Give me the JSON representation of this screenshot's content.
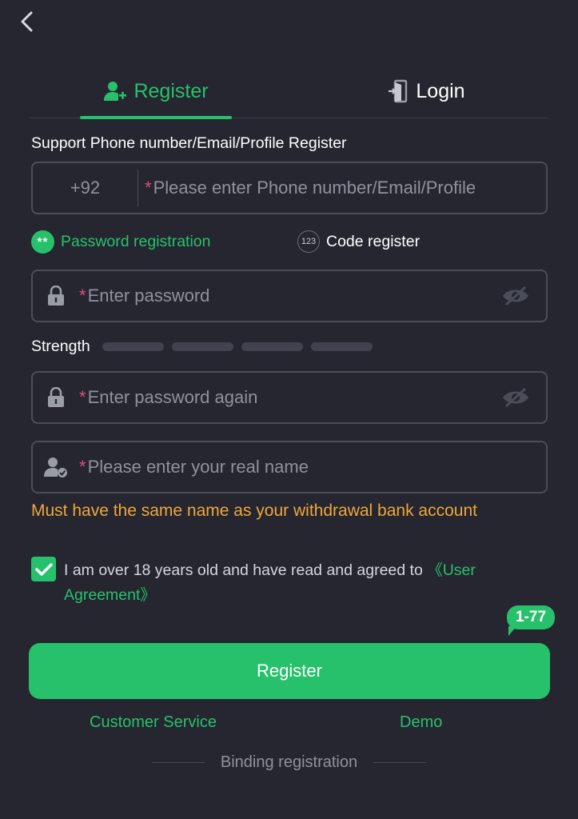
{
  "tabs": {
    "register": "Register",
    "login": "Login"
  },
  "form": {
    "support_label": "Support Phone number/Email/Profile Register",
    "country_code": "+92",
    "account_placeholder": "Please enter Phone number/Email/Profile",
    "required_mark": "*",
    "modes": {
      "password": "Password registration",
      "password_badge": "**",
      "code": "Code register",
      "code_badge": "123"
    },
    "password_placeholder": "Enter password",
    "strength_label": "Strength",
    "strength_level": 0,
    "password_again_placeholder": "Enter password again",
    "realname_placeholder": "Please enter your real name",
    "warning": "Must have the same name as your withdrawal bank account",
    "agreement_text": "I am over 18 years old and have read and agreed to ",
    "agreement_link": "《User Agreement》",
    "agreement_checked": true
  },
  "bubble": "1-77",
  "register_button": "Register",
  "links": {
    "customer_service": "Customer Service",
    "demo": "Demo",
    "binding": "Binding registration"
  },
  "colors": {
    "accent": "#27c16b",
    "background": "#252630",
    "warning": "#f0a63a",
    "required": "#e44a7a"
  }
}
